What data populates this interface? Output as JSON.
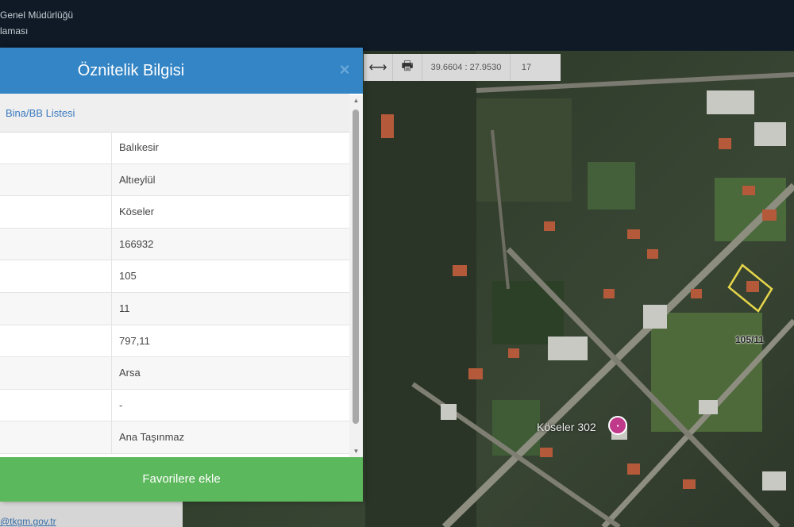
{
  "header": {
    "line1": "Genel Müdürlüğü",
    "line2": "laması"
  },
  "map_toolbar": {
    "measure_icon": "⟷",
    "print_icon": "🖶",
    "coordinates": "39.6604 : 27.9530",
    "zoom_level": "17"
  },
  "map": {
    "parcel_label": "105/11",
    "place_label": "Köseler 302",
    "poi_icon": "mosque-icon"
  },
  "footer": {
    "email_fragment": "@tkgm.gov.tr"
  },
  "panel": {
    "title": "Öznitelik Bilgisi",
    "close_label": "×",
    "list_link": "Bina/BB Listesi",
    "rows": [
      {
        "value": "Balıkesir"
      },
      {
        "value": "Altıeylül"
      },
      {
        "value": "Köseler"
      },
      {
        "value": "166932"
      },
      {
        "value": "105"
      },
      {
        "value": "11"
      },
      {
        "value": "797,11"
      },
      {
        "value": "Arsa"
      },
      {
        "value": "-"
      },
      {
        "value": "Ana Taşınmaz"
      }
    ],
    "favorite_button": "Favorilere ekle"
  },
  "colors": {
    "panel_header": "#3485c5",
    "favorite_button": "#5cb85c",
    "topbar": "#0f1a26"
  }
}
